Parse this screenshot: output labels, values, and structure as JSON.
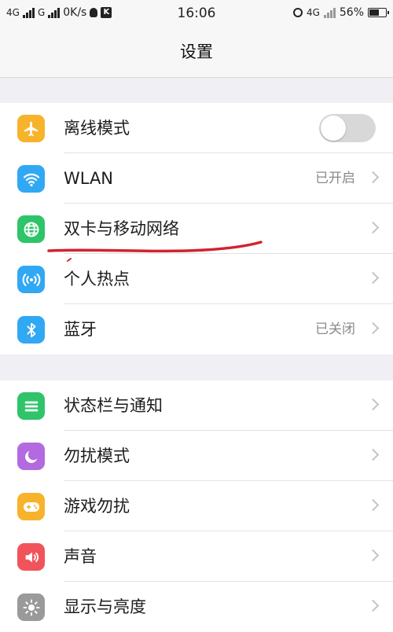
{
  "status_bar": {
    "net1": "4G",
    "net2": "G",
    "speed": "0K/s",
    "k_badge": "K",
    "time": "16:06",
    "net3": "4G",
    "battery_pct": "56%"
  },
  "nav": {
    "title": "设置"
  },
  "settings": {
    "airplane": {
      "label": "离线模式",
      "icon": "airplane-icon",
      "color": "#f7b32b",
      "on": false
    },
    "wlan": {
      "label": "WLAN",
      "value": "已开启",
      "icon": "wifi-icon",
      "color": "#31a8f3"
    },
    "dual_sim": {
      "label": "双卡与移动网络",
      "icon": "globe-icon",
      "color": "#2fc46a"
    },
    "hotspot": {
      "label": "个人热点",
      "icon": "hotspot-icon",
      "color": "#31a8f3"
    },
    "bluetooth": {
      "label": "蓝牙",
      "value": "已关闭",
      "icon": "bluetooth-icon",
      "color": "#31a8f3"
    },
    "statusbar_notify": {
      "label": "状态栏与通知",
      "icon": "notification-icon",
      "color": "#2fc46a"
    },
    "dnd": {
      "label": "勿扰模式",
      "icon": "moon-icon",
      "color": "#b36ae0"
    },
    "game_dnd": {
      "label": "游戏勿扰",
      "icon": "gamepad-icon",
      "color": "#f7b32b"
    },
    "sound": {
      "label": "声音",
      "icon": "speaker-icon",
      "color": "#f0545a"
    },
    "display": {
      "label": "显示与亮度",
      "icon": "sun-icon",
      "color": "#9a9a9a"
    }
  }
}
